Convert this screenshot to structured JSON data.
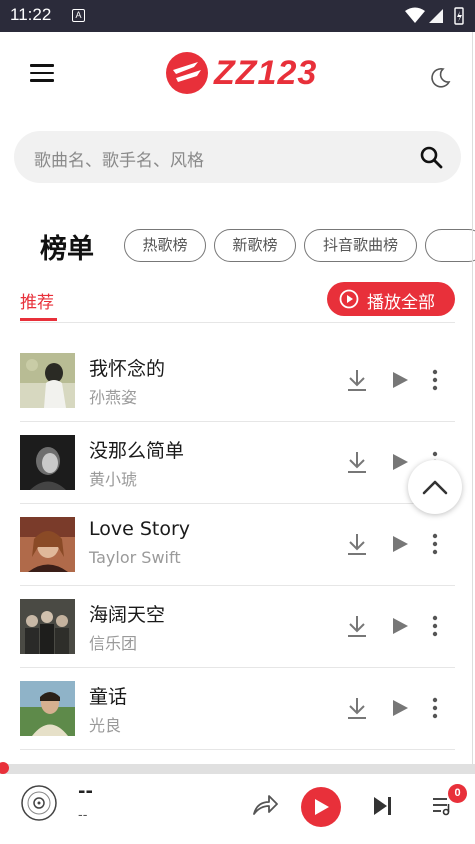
{
  "status": {
    "time": "11:22",
    "notification_glyph": "A"
  },
  "app": {
    "logo_text": "ZZ123",
    "brand_color": "#e8303a"
  },
  "search": {
    "placeholder": "歌曲名、歌手名、风格"
  },
  "charts": {
    "title": "榜单",
    "chips": [
      "热歌榜",
      "新歌榜",
      "抖音歌曲榜"
    ]
  },
  "tabs": {
    "active": "推荐"
  },
  "play_all_label": "播放全部",
  "songs": [
    {
      "title": "我怀念的",
      "artist": "孙燕姿"
    },
    {
      "title": "没那么简单",
      "artist": "黄小琥"
    },
    {
      "title": "Love Story",
      "artist": "Taylor Swift"
    },
    {
      "title": "海阔天空",
      "artist": "信乐团"
    },
    {
      "title": "童话",
      "artist": "光良"
    }
  ],
  "player": {
    "title": "--",
    "subtitle": "--",
    "queue_count": "0"
  },
  "icons": [
    "menu-icon",
    "moon-icon",
    "search-icon",
    "play-circle-icon",
    "download-icon",
    "play-icon",
    "more-vert-icon",
    "chevron-up-icon",
    "disc-icon",
    "share-icon",
    "skip-next-icon",
    "queue-icon"
  ]
}
